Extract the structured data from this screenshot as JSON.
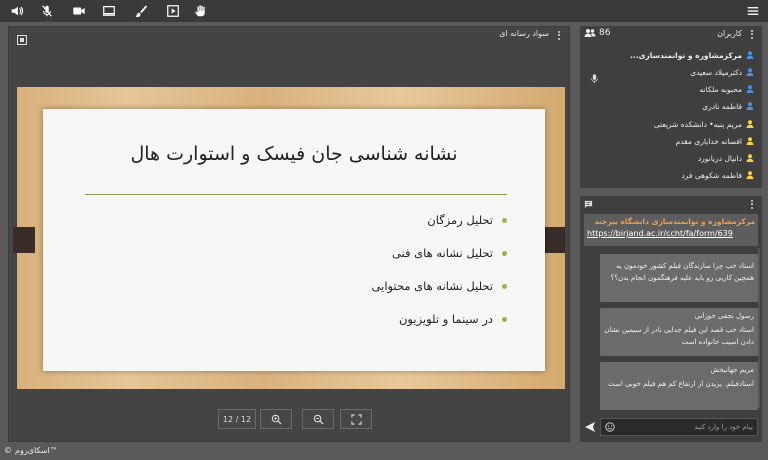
{
  "toolbar": {
    "buttons": [
      "volume-icon",
      "mic-off-icon",
      "camera-icon",
      "screen-share-icon",
      "brush-icon",
      "media-icon",
      "hand-icon"
    ],
    "menu": "hamburger-icon"
  },
  "presentation": {
    "panel_title": "سواد رسانه ای",
    "slide": {
      "title": "نشانه شناسی جان فیسک و استوارت هال",
      "bullets": [
        "تحلیل رمزگان",
        "تحلیل نشانه های فنی",
        "تحلیل نشانه های محتوایی",
        "در سینما و تلویزیون"
      ]
    },
    "page_indicator": "12 / 12"
  },
  "users": {
    "title": "کاربران",
    "count": "86",
    "list": [
      {
        "name": "مرکزمشاوره و توانمندسازی...",
        "role": "presenter",
        "color": "#4a90e2",
        "bold": true
      },
      {
        "name": "دکترمیلاد سعیدی",
        "role": "moderator",
        "color": "#4a90e2",
        "bold": false
      },
      {
        "name": "محبوبه ملکانه",
        "role": "moderator",
        "color": "#4a90e2",
        "bold": false
      },
      {
        "name": "فاطمه نادری",
        "role": "moderator",
        "color": "#4a90e2",
        "bold": false
      },
      {
        "name": "مریم پنبه• دانشکده شریعتی",
        "role": "viewer",
        "color": "#f5d33a",
        "bold": false
      },
      {
        "name": "افسانه خدایاری مقدم",
        "role": "viewer",
        "color": "#f5d33a",
        "bold": false
      },
      {
        "name": "دانیال دریانورد",
        "role": "viewer",
        "color": "#f5d33a",
        "bold": false
      },
      {
        "name": "فاطمه شکوهی فرد",
        "role": "viewer",
        "color": "#f5d33a",
        "bold": false
      }
    ]
  },
  "chat": {
    "banner_title": "مرکزمشاوره و توانمندسازی دانشگاه بیرجند",
    "banner_link": "https://birjand.ac.ir/ccht/fa/form/639",
    "messages": [
      {
        "name": "",
        "text": "استاد خب چرا سازندگان فیلم کشور خودمون یه همچین کاریی رو باید علیه فرهنگمون انجام بدن؟؟"
      },
      {
        "name": "رسول نجفی خوزانی",
        "text": "استاد خب قصد این فیلم جدایی نادر از سیمین نشان دادن اسیب خانواده است"
      },
      {
        "name": "مریم جهانبخش",
        "text": "استادفیلم. پریدن از ارتفاع کم هم فیلم خوبی است"
      }
    ],
    "input_placeholder": "پیام خود را وارد کنید"
  },
  "footer": {
    "brand": "اسکای‌روم™",
    "copyright": "©"
  },
  "colors": {
    "accent_orange": "#f2a04c",
    "moderator_blue": "#4a90e2",
    "viewer_yellow": "#f5d33a",
    "bullet_green": "#9cb14f"
  }
}
